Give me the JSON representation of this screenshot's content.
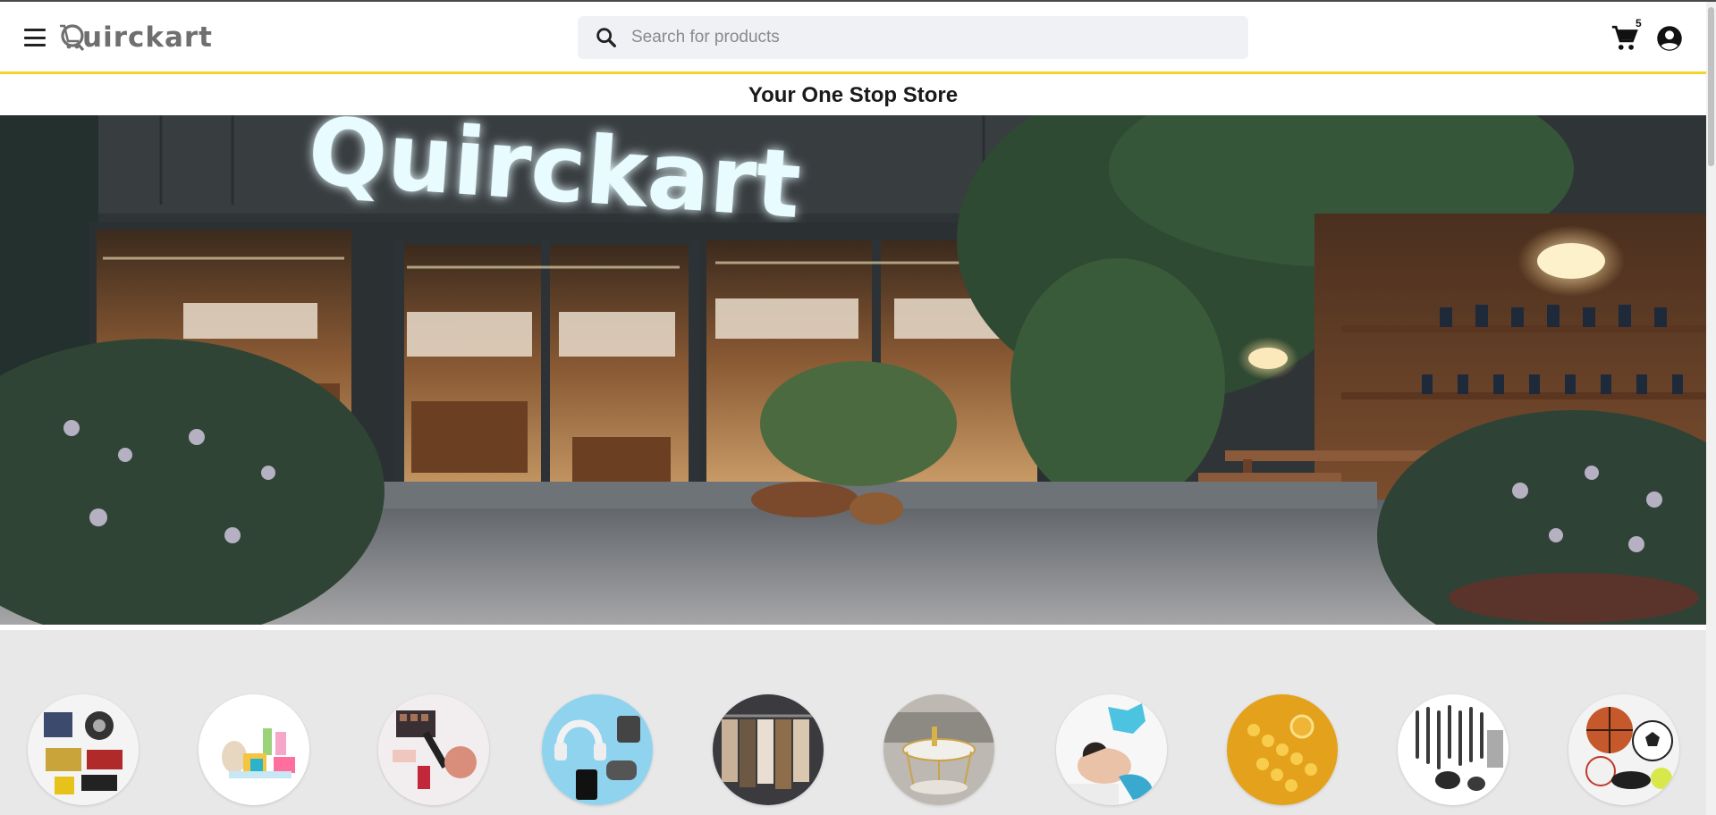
{
  "header": {
    "logo_text": "uirckart",
    "search_placeholder": "Search for products",
    "cart_count": "5"
  },
  "banner": {
    "tagline": "Your One Stop Store",
    "sign_text": "Quirckart"
  },
  "categories": [
    {
      "icon": "auto-accessories"
    },
    {
      "icon": "baby-products"
    },
    {
      "icon": "beauty"
    },
    {
      "icon": "electronics"
    },
    {
      "icon": "fashion"
    },
    {
      "icon": "furniture"
    },
    {
      "icon": "health-care"
    },
    {
      "icon": "jewellery"
    },
    {
      "icon": "kitchen"
    },
    {
      "icon": "sports"
    }
  ],
  "colors": {
    "accent": "#f5d327",
    "search_bg": "#f0f1f5",
    "category_bg": "#e8e8e8",
    "sign_glow": "#e8fbff"
  }
}
